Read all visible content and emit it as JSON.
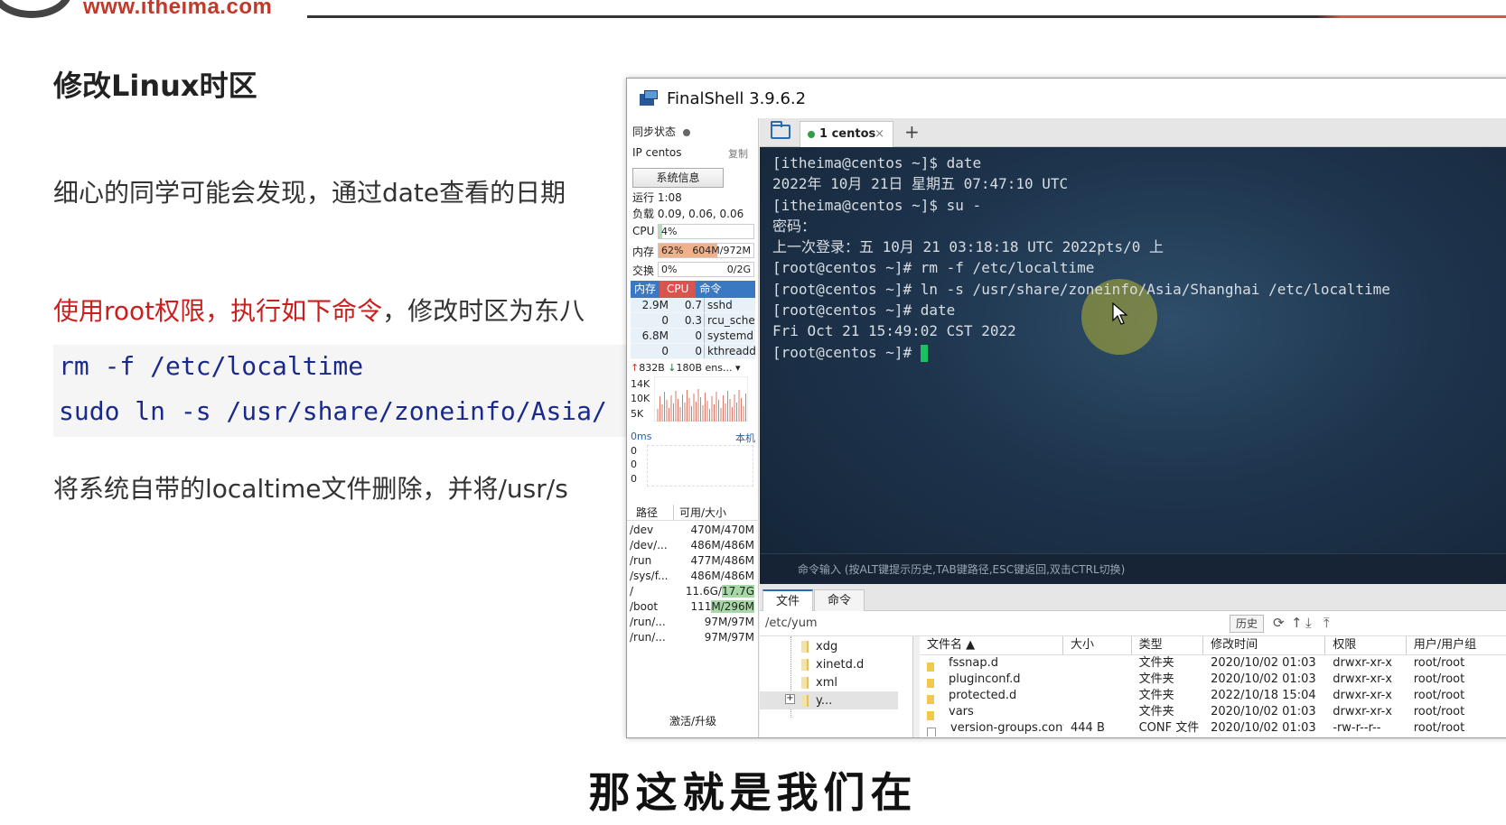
{
  "slide": {
    "logo_url": "www.itheima.com",
    "title": "修改Linux时区",
    "para1": "细心的同学可能会发现，通过date查看的日期",
    "para2_red": "使用root权限，执行如下命令",
    "para2_rest": "，修改时区为东八",
    "code_lines": [
      "rm -f /etc/localtime",
      "sudo ln -s /usr/share/zoneinfo/Asia/"
    ],
    "para3": "将系统自带的localtime文件删除，并将/usr/s",
    "subtitle": "那这就是我们在",
    "accent_red": "#c91f1f"
  },
  "window": {
    "title": "FinalShell 3.9.6.2"
  },
  "sidebar": {
    "sync_label": "同步状态",
    "ip_label": "IP centos",
    "copy_label": "复制",
    "sysinfo_button": "系统信息",
    "uptime": "运行 1:08",
    "load": "负载 0.09, 0.06, 0.06",
    "cpu": {
      "label": "CPU",
      "value_text": "4%",
      "percent": 4
    },
    "mem": {
      "label": "内存",
      "value_text": "62%",
      "detail": "604M/972M",
      "percent": 62
    },
    "swap": {
      "label": "交换",
      "value_text": "0%",
      "detail": "0/2G",
      "percent": 0
    },
    "proc_headers": [
      "内存",
      "CPU",
      "命令"
    ],
    "procs": [
      {
        "mem": "2.9M",
        "cpu": "0.7",
        "cmd": "sshd"
      },
      {
        "mem": "0",
        "cpu": "0.3",
        "cmd": "rcu_sche"
      },
      {
        "mem": "6.8M",
        "cpu": "0",
        "cmd": "systemd"
      },
      {
        "mem": "0",
        "cpu": "0",
        "cmd": "kthreadd"
      }
    ],
    "net_up": "832B",
    "net_down": "180B",
    "net_iface": "ens...",
    "net_labels": [
      "14K",
      "10K",
      "5K"
    ],
    "ping_ms": "0ms",
    "ping_host": "本机",
    "ping_labels": [
      "0",
      "0",
      "0"
    ],
    "disk_headers": [
      "路径",
      "可用/大小"
    ],
    "disks": [
      {
        "path": "/dev",
        "size": "470M/470M"
      },
      {
        "path": "/dev/...",
        "size": "486M/486M"
      },
      {
        "path": "/run",
        "size": "477M/486M"
      },
      {
        "path": "/sys/f...",
        "size": "486M/486M"
      },
      {
        "path": "/",
        "size_a": "11.6G/",
        "size_b": "17.7G"
      },
      {
        "path": "/boot",
        "size_a": "111",
        "size_b": "M/296M"
      },
      {
        "path": "/run/...",
        "size": "97M/97M"
      },
      {
        "path": "/run/...",
        "size": "97M/97M"
      }
    ],
    "activate_label": "激活/升级"
  },
  "tabs": {
    "active_label": "1 centos",
    "close_glyph": "×",
    "add_glyph": "+"
  },
  "terminal": {
    "lines": [
      "[itheima@centos ~]$ date",
      "2022年 10月 21日 星期五 07:47:10 UTC",
      "[itheima@centos ~]$ su -",
      "密码：",
      "上一次登录：五 10月 21 03:18:18 UTC 2022pts/0 上",
      "[root@centos ~]# rm -f /etc/localtime",
      "[root@centos ~]# ln -s /usr/share/zoneinfo/Asia/Shanghai /etc/localtime",
      "[root@centos ~]# date",
      "Fri Oct 21 15:49:02 CST 2022"
    ],
    "prompt": "[root@centos ~]# ",
    "cmd_input_hint": "命令输入 (按ALT键提示历史,TAB键路径,ESC键返回,双击CTRL切换)"
  },
  "bottom": {
    "tab_files": "文件",
    "tab_commands": "命令",
    "path": "/etc/yum",
    "history_button": "历史",
    "tree_items": [
      "xdg",
      "xinetd.d",
      "xml",
      "y..."
    ],
    "file_headers": [
      "文件名 ▲",
      "大小",
      "类型",
      "修改时间",
      "权限",
      "用户/用户组"
    ],
    "files": [
      {
        "name": "fssnap.d",
        "size": "",
        "type": "文件夹",
        "mtime": "2020/10/02 01:03",
        "perm": "drwxr-xr-x",
        "owner": "root/root"
      },
      {
        "name": "pluginconf.d",
        "size": "",
        "type": "文件夹",
        "mtime": "2020/10/02 01:03",
        "perm": "drwxr-xr-x",
        "owner": "root/root"
      },
      {
        "name": "protected.d",
        "size": "",
        "type": "文件夹",
        "mtime": "2022/10/18 15:04",
        "perm": "drwxr-xr-x",
        "owner": "root/root"
      },
      {
        "name": "vars",
        "size": "",
        "type": "文件夹",
        "mtime": "2020/10/02 01:03",
        "perm": "drwxr-xr-x",
        "owner": "root/root"
      },
      {
        "name": "version-groups.conf",
        "size": "444 B",
        "type": "CONF 文件",
        "mtime": "2020/10/02 01:03",
        "perm": "-rw-r--r--",
        "owner": "root/root"
      }
    ]
  }
}
